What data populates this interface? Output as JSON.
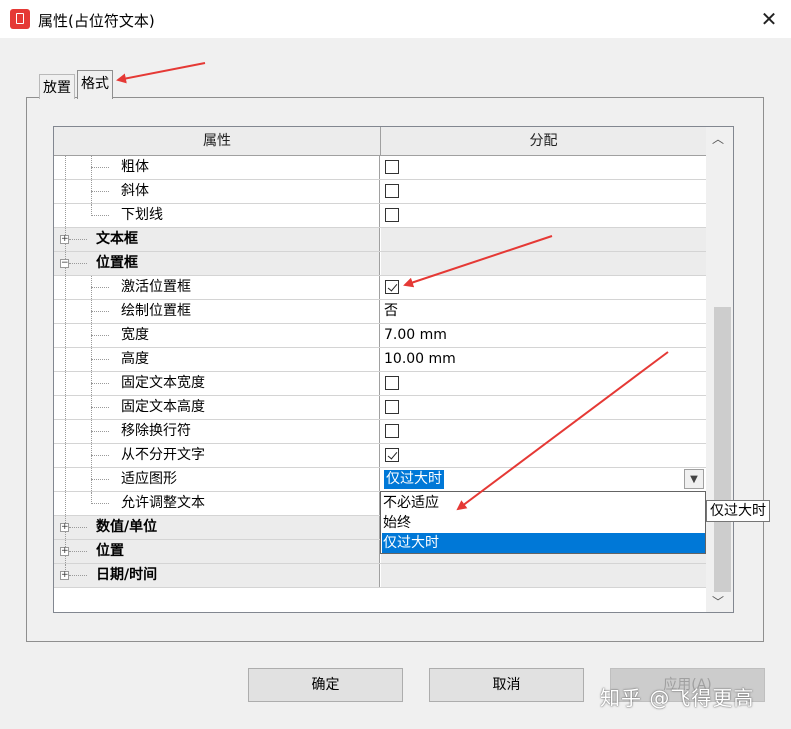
{
  "window": {
    "title": "属性(占位符文本)",
    "close_glyph": "✕"
  },
  "tabs": [
    {
      "label": "放置",
      "active": false
    },
    {
      "label": "格式",
      "active": true
    }
  ],
  "grid": {
    "headers": {
      "property": "属性",
      "value": "分配"
    },
    "rows": [
      {
        "label": "粗体",
        "value": ""
      },
      {
        "label": "斜体",
        "value": ""
      },
      {
        "label": "下划线",
        "value": ""
      },
      {
        "label": "文本框",
        "value": "",
        "expander": "+"
      },
      {
        "label": "位置框",
        "value": "",
        "expander": "−"
      },
      {
        "label": "激活位置框",
        "value": ""
      },
      {
        "label": "绘制位置框",
        "value": "否"
      },
      {
        "label": "宽度",
        "value": "7.00 mm"
      },
      {
        "label": "高度",
        "value": "10.00 mm"
      },
      {
        "label": "固定文本宽度",
        "value": ""
      },
      {
        "label": "固定文本高度",
        "value": ""
      },
      {
        "label": "移除换行符",
        "value": ""
      },
      {
        "label": "从不分开文字",
        "value": ""
      },
      {
        "label": "适应图形",
        "value": "仅过大时"
      },
      {
        "label": "允许调整文本",
        "value": ""
      },
      {
        "label": "数值/单位",
        "value": "",
        "expander": "+"
      },
      {
        "label": "位置",
        "value": "",
        "expander": "+"
      },
      {
        "label": "日期/时间",
        "value": "",
        "expander": "+"
      }
    ],
    "checkboxes": {
      "bold": false,
      "italic": false,
      "underline": false,
      "activate_frame": true,
      "fixed_width": false,
      "fixed_height": false,
      "remove_linebreaks": false,
      "never_split": true
    }
  },
  "dropdown": {
    "options": [
      "不必适应",
      "始终",
      "仅过大时"
    ],
    "selected": "仅过大时"
  },
  "tooltip": "仅过大时",
  "buttons": {
    "ok": "确定",
    "cancel": "取消",
    "apply": "应用(A)"
  },
  "watermark": "知乎 @飞得更高",
  "colors": {
    "selection": "#0078d7",
    "annotation_arrow": "#e53935",
    "app_icon": "#e53935"
  }
}
